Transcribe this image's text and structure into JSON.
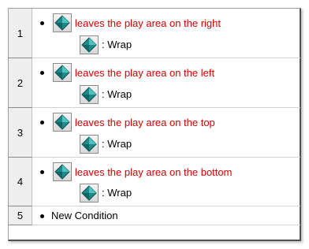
{
  "events": [
    {
      "number": "1",
      "condition": "leaves the play area on the right",
      "action": ": Wrap",
      "condition_icon": "diamond-object-icon",
      "action_icon": "diamond-object-icon"
    },
    {
      "number": "2",
      "condition": "leaves the play area on the left",
      "action": ": Wrap",
      "condition_icon": "diamond-object-icon",
      "action_icon": "diamond-object-icon"
    },
    {
      "number": "3",
      "condition": "leaves the play area on the top",
      "action": ": Wrap",
      "condition_icon": "diamond-object-icon",
      "action_icon": "diamond-object-icon"
    },
    {
      "number": "4",
      "condition": "leaves the play area on the bottom",
      "action": ": Wrap",
      "condition_icon": "diamond-object-icon",
      "action_icon": "diamond-object-icon"
    }
  ],
  "new_condition": {
    "number": "5",
    "label": "New Condition"
  },
  "colors": {
    "condition_text": "#d40000",
    "icon_teal": "#1e8a8a"
  }
}
